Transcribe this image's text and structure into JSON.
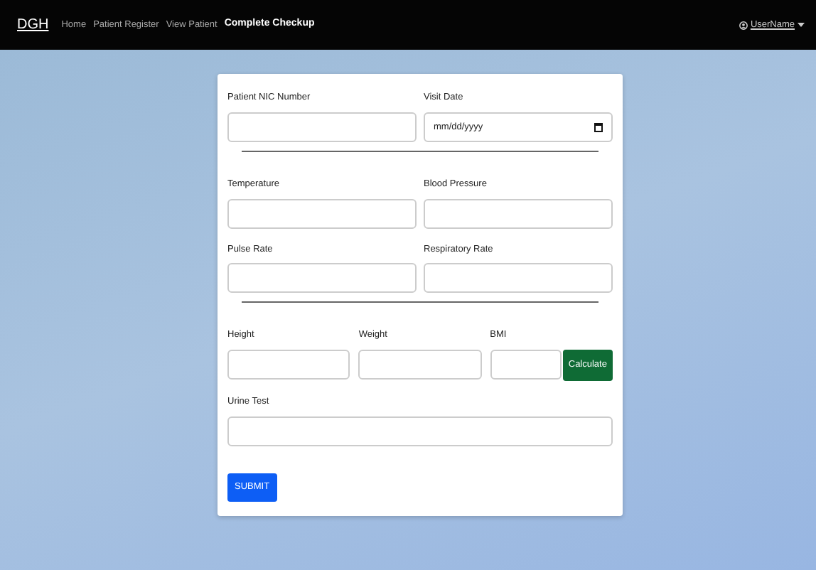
{
  "navbar": {
    "brand": "DGH",
    "links": [
      {
        "label": "Home",
        "selected": false
      },
      {
        "label": "Patient Register",
        "selected": false
      },
      {
        "label": "View Patient",
        "selected": false
      },
      {
        "label": "Complete Checkup",
        "selected": true
      }
    ],
    "user": "UserName"
  },
  "form": {
    "rows": [
      {
        "fields": [
          {
            "label": "Patient NIC Number",
            "kind": "text"
          },
          {
            "label": "Visit Date",
            "kind": "date",
            "placeholder": "mm/dd/yyyy"
          }
        ],
        "divider": true
      },
      {
        "fields": [
          {
            "label": "Temperature",
            "kind": "text"
          },
          {
            "label": "Blood Pressure",
            "kind": "text"
          }
        ],
        "divider": false
      },
      {
        "fields": [
          {
            "label": "Pulse Rate",
            "kind": "text"
          },
          {
            "label": "Respiratory Rate",
            "kind": "text"
          }
        ],
        "divider": true
      },
      {
        "fields": [
          {
            "label": "Height",
            "kind": "text"
          },
          {
            "label": "Weight",
            "kind": "text"
          },
          {
            "label": "BMI",
            "kind": "calc",
            "button": "Calculate"
          }
        ],
        "divider": false
      },
      {
        "fields": [
          {
            "label": "Urine Test",
            "kind": "text"
          }
        ],
        "divider": false
      }
    ],
    "submit": "SUBMIT"
  }
}
